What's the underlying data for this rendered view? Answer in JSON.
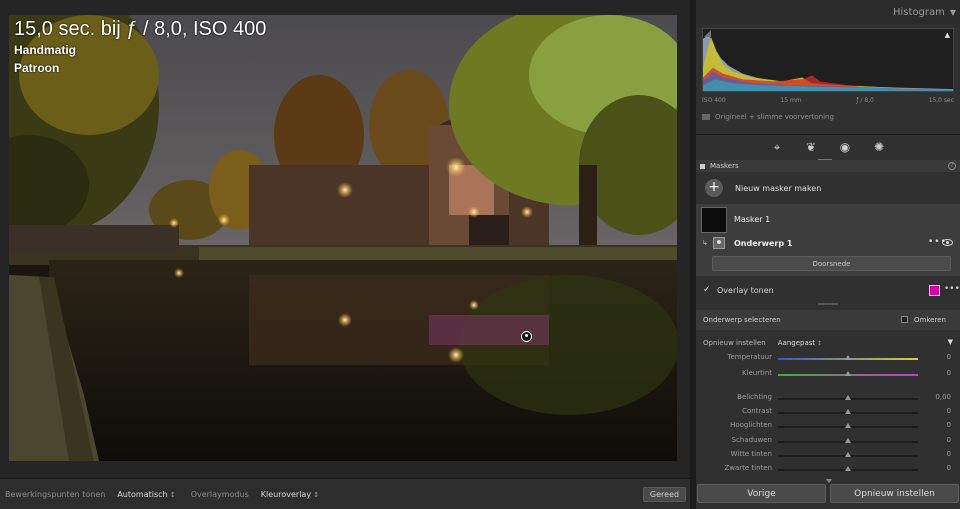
{
  "photo": {
    "exposure_info": "15,0 sec. bij ƒ / 8,0, ISO 400",
    "mode": "Handmatig",
    "metering": "Patroon"
  },
  "toolbar": {
    "edit_pins_label": "Bewerkingspunten tonen",
    "edit_pins_value": "Automatisch",
    "overlay_mode_label": "Overlaymodus",
    "overlay_mode_value": "Kleuroverlay",
    "done_label": "Gereed"
  },
  "histogram": {
    "title": "Histogram",
    "iso": "ISO 400",
    "focal": "15 mm",
    "aperture": "ƒ / 8,0",
    "shutter": "15,0 sec",
    "preview_label": "Origineel + slimme voorvertoning"
  },
  "masks": {
    "header": "Maskers",
    "new_mask_label": "Nieuw masker maken",
    "mask_name": "Masker 1",
    "component_name": "Onderwerp 1",
    "intersect_label": "Doorsnede",
    "overlay_label": "Overlay tonen",
    "overlay_color": "#d400a8"
  },
  "subject": {
    "title": "Onderwerp selecteren",
    "invert_label": "Omkeren"
  },
  "adjust": {
    "reset_label": "Opnieuw instellen",
    "preset_value": "Aangepast",
    "sliders": [
      {
        "name": "Temperatuur",
        "value": "0",
        "pos": 0.5
      },
      {
        "name": "Kleurtint",
        "value": "0",
        "pos": 0.5
      },
      {
        "name": "Belichting",
        "value": "0,00",
        "pos": 0.5
      },
      {
        "name": "Contrast",
        "value": "0",
        "pos": 0.5
      },
      {
        "name": "Hooglichten",
        "value": "0",
        "pos": 0.5
      },
      {
        "name": "Schaduwen",
        "value": "0",
        "pos": 0.5
      },
      {
        "name": "Witte tinten",
        "value": "0",
        "pos": 0.5
      },
      {
        "name": "Zwarte tinten",
        "value": "0",
        "pos": 0.5
      }
    ]
  },
  "bottom": {
    "previous_label": "Vorige",
    "reset_label": "Opnieuw instellen"
  },
  "colors": {
    "temperature_gradient": [
      "#3b55c9",
      "#d6d23a"
    ],
    "tint_gradient": [
      "#3fae3f",
      "#c63cc6"
    ]
  }
}
